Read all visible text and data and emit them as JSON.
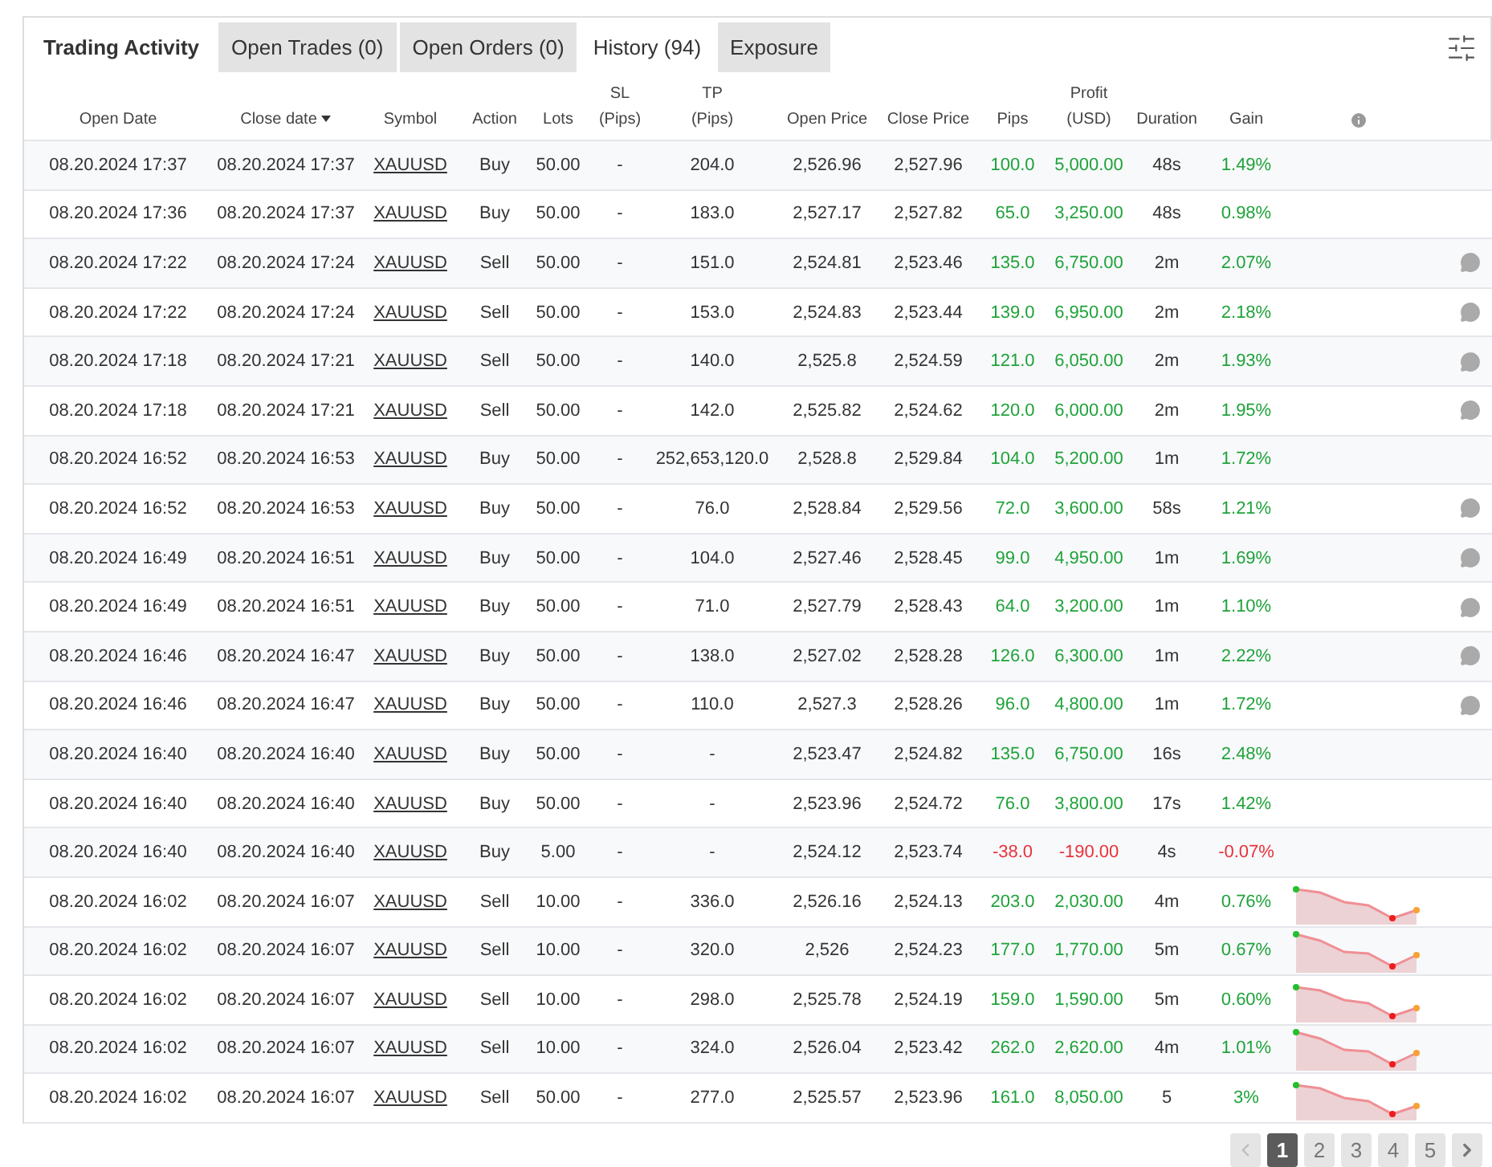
{
  "title": "Trading Activity",
  "tabs": [
    {
      "label": "Open Trades (0)",
      "selected": false
    },
    {
      "label": "Open Orders (0)",
      "selected": false
    },
    {
      "label": "History (94)",
      "selected": true
    },
    {
      "label": "Exposure",
      "selected": false
    }
  ],
  "columns": [
    {
      "label": "Open Date"
    },
    {
      "label": "Close date",
      "sorted": true
    },
    {
      "label": "Symbol"
    },
    {
      "label": "Action"
    },
    {
      "label": "Lots"
    },
    {
      "label": "SL",
      "sub": "(Pips)"
    },
    {
      "label": "TP",
      "sub": "(Pips)"
    },
    {
      "label": "Open Price"
    },
    {
      "label": "Close Price"
    },
    {
      "label": "Pips"
    },
    {
      "label": "Profit",
      "sub": "(USD)"
    },
    {
      "label": "Duration"
    },
    {
      "label": "Gain"
    }
  ],
  "rows": [
    {
      "open": "08.20.2024 17:37",
      "close": "08.20.2024 17:37",
      "symbol": "XAUUSD",
      "action": "Buy",
      "lots": "50.00",
      "sl": "-",
      "tp": "204.0",
      "open_price": "2,526.96",
      "close_price": "2,527.96",
      "pips": "100.0",
      "profit": "5,000.00",
      "duration": "48s",
      "gain": "1.49%",
      "color": "#1fa33a",
      "trend": false,
      "comment": false
    },
    {
      "open": "08.20.2024 17:36",
      "close": "08.20.2024 17:37",
      "symbol": "XAUUSD",
      "action": "Buy",
      "lots": "50.00",
      "sl": "-",
      "tp": "183.0",
      "open_price": "2,527.17",
      "close_price": "2,527.82",
      "pips": "65.0",
      "profit": "3,250.00",
      "duration": "48s",
      "gain": "0.98%",
      "color": "#1fa33a",
      "trend": false,
      "comment": false
    },
    {
      "open": "08.20.2024 17:22",
      "close": "08.20.2024 17:24",
      "symbol": "XAUUSD",
      "action": "Sell",
      "lots": "50.00",
      "sl": "-",
      "tp": "151.0",
      "open_price": "2,524.81",
      "close_price": "2,523.46",
      "pips": "135.0",
      "profit": "6,750.00",
      "duration": "2m",
      "gain": "2.07%",
      "color": "#1fa33a",
      "trend": false,
      "comment": true
    },
    {
      "open": "08.20.2024 17:22",
      "close": "08.20.2024 17:24",
      "symbol": "XAUUSD",
      "action": "Sell",
      "lots": "50.00",
      "sl": "-",
      "tp": "153.0",
      "open_price": "2,524.83",
      "close_price": "2,523.44",
      "pips": "139.0",
      "profit": "6,950.00",
      "duration": "2m",
      "gain": "2.18%",
      "color": "#1fa33a",
      "trend": false,
      "comment": true
    },
    {
      "open": "08.20.2024 17:18",
      "close": "08.20.2024 17:21",
      "symbol": "XAUUSD",
      "action": "Sell",
      "lots": "50.00",
      "sl": "-",
      "tp": "140.0",
      "open_price": "2,525.8",
      "close_price": "2,524.59",
      "pips": "121.0",
      "profit": "6,050.00",
      "duration": "2m",
      "gain": "1.93%",
      "color": "#1fa33a",
      "trend": false,
      "comment": true
    },
    {
      "open": "08.20.2024 17:18",
      "close": "08.20.2024 17:21",
      "symbol": "XAUUSD",
      "action": "Sell",
      "lots": "50.00",
      "sl": "-",
      "tp": "142.0",
      "open_price": "2,525.82",
      "close_price": "2,524.62",
      "pips": "120.0",
      "profit": "6,000.00",
      "duration": "2m",
      "gain": "1.95%",
      "color": "#1fa33a",
      "trend": false,
      "comment": true
    },
    {
      "open": "08.20.2024 16:52",
      "close": "08.20.2024 16:53",
      "symbol": "XAUUSD",
      "action": "Buy",
      "lots": "50.00",
      "sl": "-",
      "tp": "252,653,120.0",
      "open_price": "2,528.8",
      "close_price": "2,529.84",
      "pips": "104.0",
      "profit": "5,200.00",
      "duration": "1m",
      "gain": "1.72%",
      "color": "#1fa33a",
      "trend": false,
      "comment": false
    },
    {
      "open": "08.20.2024 16:52",
      "close": "08.20.2024 16:53",
      "symbol": "XAUUSD",
      "action": "Buy",
      "lots": "50.00",
      "sl": "-",
      "tp": "76.0",
      "open_price": "2,528.84",
      "close_price": "2,529.56",
      "pips": "72.0",
      "profit": "3,600.00",
      "duration": "58s",
      "gain": "1.21%",
      "color": "#1fa33a",
      "trend": false,
      "comment": true
    },
    {
      "open": "08.20.2024 16:49",
      "close": "08.20.2024 16:51",
      "symbol": "XAUUSD",
      "action": "Buy",
      "lots": "50.00",
      "sl": "-",
      "tp": "104.0",
      "open_price": "2,527.46",
      "close_price": "2,528.45",
      "pips": "99.0",
      "profit": "4,950.00",
      "duration": "1m",
      "gain": "1.69%",
      "color": "#1fa33a",
      "trend": false,
      "comment": true
    },
    {
      "open": "08.20.2024 16:49",
      "close": "08.20.2024 16:51",
      "symbol": "XAUUSD",
      "action": "Buy",
      "lots": "50.00",
      "sl": "-",
      "tp": "71.0",
      "open_price": "2,527.79",
      "close_price": "2,528.43",
      "pips": "64.0",
      "profit": "3,200.00",
      "duration": "1m",
      "gain": "1.10%",
      "color": "#1fa33a",
      "trend": false,
      "comment": true
    },
    {
      "open": "08.20.2024 16:46",
      "close": "08.20.2024 16:47",
      "symbol": "XAUUSD",
      "action": "Buy",
      "lots": "50.00",
      "sl": "-",
      "tp": "138.0",
      "open_price": "2,527.02",
      "close_price": "2,528.28",
      "pips": "126.0",
      "profit": "6,300.00",
      "duration": "1m",
      "gain": "2.22%",
      "color": "#1fa33a",
      "trend": false,
      "comment": true
    },
    {
      "open": "08.20.2024 16:46",
      "close": "08.20.2024 16:47",
      "symbol": "XAUUSD",
      "action": "Buy",
      "lots": "50.00",
      "sl": "-",
      "tp": "110.0",
      "open_price": "2,527.3",
      "close_price": "2,528.26",
      "pips": "96.0",
      "profit": "4,800.00",
      "duration": "1m",
      "gain": "1.72%",
      "color": "#1fa33a",
      "trend": false,
      "comment": true
    },
    {
      "open": "08.20.2024 16:40",
      "close": "08.20.2024 16:40",
      "symbol": "XAUUSD",
      "action": "Buy",
      "lots": "50.00",
      "sl": "-",
      "tp": "-",
      "open_price": "2,523.47",
      "close_price": "2,524.82",
      "pips": "135.0",
      "profit": "6,750.00",
      "duration": "16s",
      "gain": "2.48%",
      "color": "#1fa33a",
      "trend": false,
      "comment": false
    },
    {
      "open": "08.20.2024 16:40",
      "close": "08.20.2024 16:40",
      "symbol": "XAUUSD",
      "action": "Buy",
      "lots": "50.00",
      "sl": "-",
      "tp": "-",
      "open_price": "2,523.96",
      "close_price": "2,524.72",
      "pips": "76.0",
      "profit": "3,800.00",
      "duration": "17s",
      "gain": "1.42%",
      "color": "#1fa33a",
      "trend": false,
      "comment": false
    },
    {
      "open": "08.20.2024 16:40",
      "close": "08.20.2024 16:40",
      "symbol": "XAUUSD",
      "action": "Buy",
      "lots": "5.00",
      "sl": "-",
      "tp": "-",
      "open_price": "2,524.12",
      "close_price": "2,523.74",
      "pips": "-38.0",
      "profit": "-190.00",
      "duration": "4s",
      "gain": "-0.07%",
      "color": "#e8333a",
      "trend": false,
      "comment": false
    },
    {
      "open": "08.20.2024 16:02",
      "close": "08.20.2024 16:07",
      "symbol": "XAUUSD",
      "action": "Sell",
      "lots": "10.00",
      "sl": "-",
      "tp": "336.0",
      "open_price": "2,526.16",
      "close_price": "2,524.13",
      "pips": "203.0",
      "profit": "2,030.00",
      "duration": "4m",
      "gain": "0.76%",
      "color": "#1fa33a",
      "trend": true,
      "comment": false
    },
    {
      "open": "08.20.2024 16:02",
      "close": "08.20.2024 16:07",
      "symbol": "XAUUSD",
      "action": "Sell",
      "lots": "10.00",
      "sl": "-",
      "tp": "320.0",
      "open_price": "2,526",
      "close_price": "2,524.23",
      "pips": "177.0",
      "profit": "1,770.00",
      "duration": "5m",
      "gain": "0.67%",
      "color": "#1fa33a",
      "trend": true,
      "comment": false
    },
    {
      "open": "08.20.2024 16:02",
      "close": "08.20.2024 16:07",
      "symbol": "XAUUSD",
      "action": "Sell",
      "lots": "10.00",
      "sl": "-",
      "tp": "298.0",
      "open_price": "2,525.78",
      "close_price": "2,524.19",
      "pips": "159.0",
      "profit": "1,590.00",
      "duration": "5m",
      "gain": "0.60%",
      "color": "#1fa33a",
      "trend": true,
      "comment": false
    },
    {
      "open": "08.20.2024 16:02",
      "close": "08.20.2024 16:07",
      "symbol": "XAUUSD",
      "action": "Sell",
      "lots": "10.00",
      "sl": "-",
      "tp": "324.0",
      "open_price": "2,526.04",
      "close_price": "2,523.42",
      "pips": "262.0",
      "profit": "2,620.00",
      "duration": "4m",
      "gain": "1.01%",
      "color": "#1fa33a",
      "trend": true,
      "comment": false
    },
    {
      "open": "08.20.2024 16:02",
      "close": "08.20.2024 16:07",
      "symbol": "XAUUSD",
      "action": "Sell",
      "lots": "50.00",
      "sl": "-",
      "tp": "277.0",
      "open_price": "2,525.57",
      "close_price": "2,523.96",
      "pips": "161.0",
      "profit": "8,050.00",
      "duration": "5",
      "gain": "3%",
      "color": "#1fa33a",
      "trend": true,
      "comment": false
    }
  ],
  "pagination": {
    "prev": {
      "disabled": true
    },
    "pages": [
      {
        "label": "1",
        "selected": true
      },
      {
        "label": "2",
        "selected": false
      },
      {
        "label": "3",
        "selected": false
      },
      {
        "label": "4",
        "selected": false
      },
      {
        "label": "5",
        "selected": false
      }
    ],
    "next": {
      "disabled": false
    }
  }
}
